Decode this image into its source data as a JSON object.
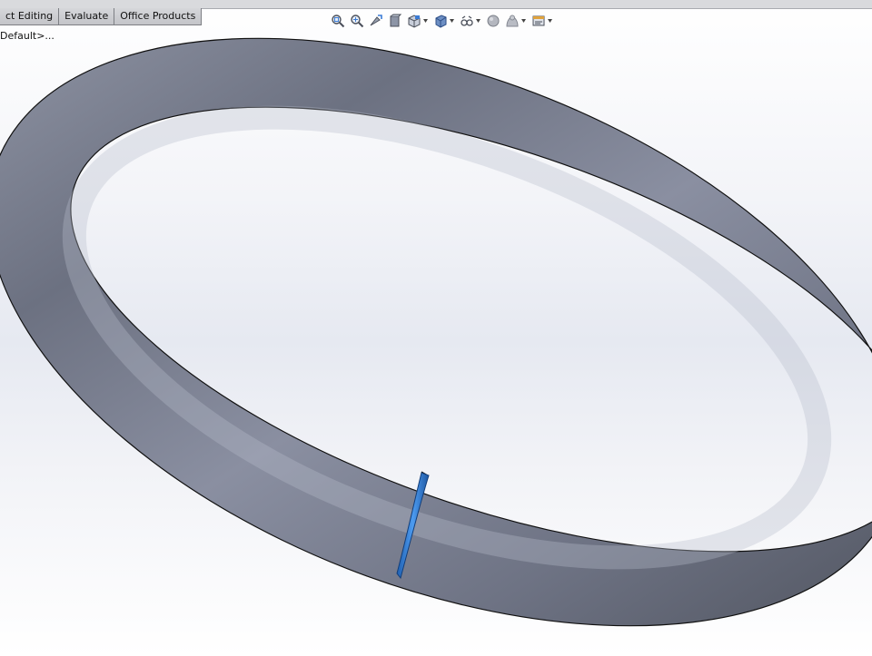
{
  "command_manager": {
    "tabs": [
      {
        "label": "ct Editing"
      },
      {
        "label": "Evaluate"
      },
      {
        "label": "Office Products"
      }
    ]
  },
  "feature_manager": {
    "configuration_label": "Default>..."
  },
  "heads_up_toolbar": {
    "icons": [
      "zoom-to-fit-icon",
      "zoom-to-area-icon",
      "previous-view-icon",
      "section-view-icon",
      "view-orientation-icon",
      "display-style-icon",
      "hide-show-items-icon",
      "edit-appearance-icon",
      "apply-scene-icon",
      "view-settings-icon"
    ]
  },
  "colors": {
    "background_top": "#ffffff",
    "background_mid": "#e6e9f1",
    "model_shade_dark": "#5a5f6e",
    "model_shade_light": "#9ea3b4",
    "selected_face": "#2f78c8",
    "tab_bar": "#c8c9cc"
  }
}
